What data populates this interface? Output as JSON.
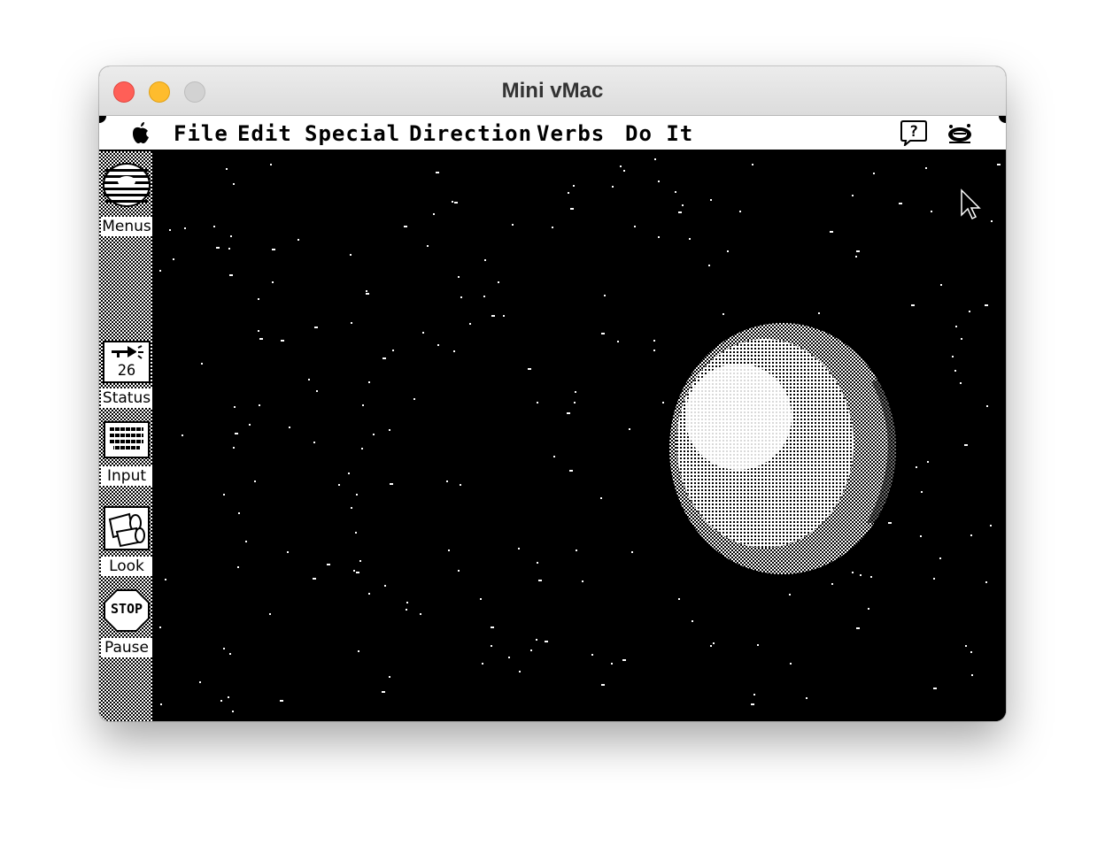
{
  "window": {
    "title": "Mini vMac"
  },
  "menubar": {
    "apple_icon": "apple-icon",
    "items": [
      {
        "label": "File"
      },
      {
        "label": "Edit"
      },
      {
        "label": "Special"
      },
      {
        "label": "Direction"
      },
      {
        "label": "Verbs"
      },
      {
        "label": "Do It"
      }
    ],
    "help_icon": "help-balloon-icon",
    "app_icon": "application-icon"
  },
  "sidebar": {
    "menus_label": "Menus",
    "status_label": "Status",
    "status_value": "26",
    "input_label": "Input",
    "look_label": "Look",
    "stop_text": "STOP",
    "pause_label": "Pause"
  },
  "colors": {
    "close": "#ff5f57",
    "minimize": "#febc2e",
    "maximize": "#d2d2d2",
    "screen_background": "#000000",
    "pixel_white": "#ffffff"
  }
}
